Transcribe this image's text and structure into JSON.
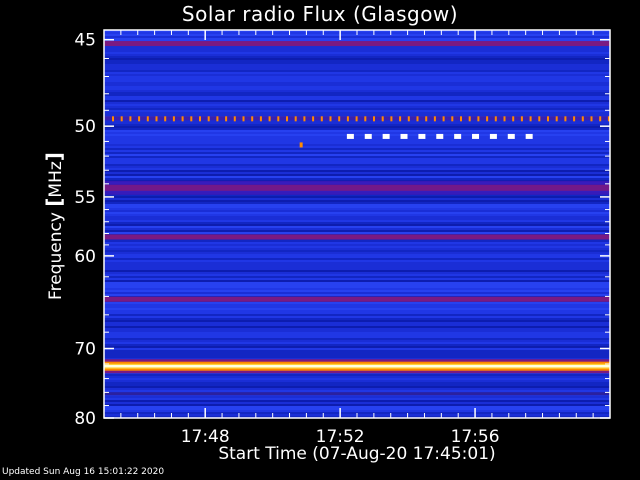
{
  "chart_data": {
    "type": "heatmap",
    "title": "Solar radio Flux (Glasgow)",
    "xlabel": "Start Time (07-Aug-20 17:45:01)",
    "ylabel": "Frequency [MHz]",
    "ylabel_parts": {
      "pre": "Frequency ",
      "bl": "[",
      "unit": "MHz",
      "br": "]"
    },
    "xticks_minutes": [
      3,
      7,
      11
    ],
    "xtick_labels": [
      "17:48",
      "17:52",
      "17:56"
    ],
    "xlim_minutes": [
      0,
      15
    ],
    "yticks": [
      45,
      50,
      55,
      60,
      70,
      80
    ],
    "ylim": [
      44.5,
      80
    ],
    "y_scale": "reciprocal",
    "colors": {
      "background": "#000000",
      "base": "#1a2ed6",
      "band_strong": "#ffffe0",
      "band_orange": "#ff8a00",
      "band_purple": "#7a1a82",
      "axis": "#ffffff"
    },
    "bands": [
      {
        "freq": 45.2,
        "level": "purple"
      },
      {
        "freq": 49.5,
        "level": "dotted_orange"
      },
      {
        "freq": 54.3,
        "level": "purple_wide"
      },
      {
        "freq": 58.3,
        "level": "purple"
      },
      {
        "freq": 64.3,
        "level": "purple"
      },
      {
        "freq": 72.3,
        "level": "strong"
      },
      {
        "freq": 76.2,
        "level": "faint"
      }
    ],
    "markers": [
      {
        "label": "white-markers",
        "freq": 50.7,
        "t_start": 7.2,
        "t_end": 12.5
      }
    ],
    "updated": "Updated Sun Aug 16 15:01:22 2020"
  }
}
